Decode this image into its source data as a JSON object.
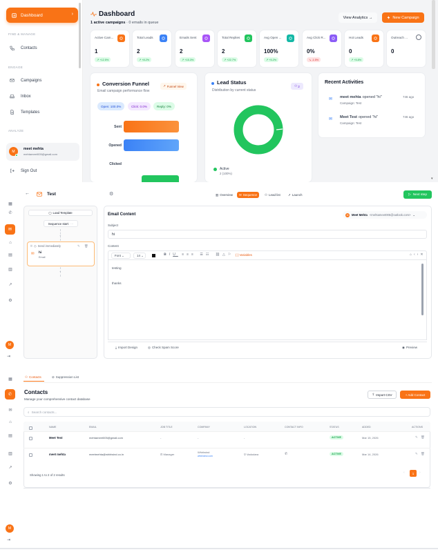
{
  "dashboard": {
    "nav": {
      "active": "Dashboard",
      "section_find": "FIND & MANAGE",
      "contacts": "Contacts",
      "section_engage": "ENGAGE",
      "campaigns": "Campaigns",
      "inbox": "Inbox",
      "templates": "Templates",
      "section_analyze": "ANALYZE",
      "user_name": "meet mehta",
      "user_email": "mehtameet005@gmail.com",
      "user_initial": "M",
      "sign_out": "Sign Out"
    },
    "title": "Dashboard",
    "subtitle_bold": "1 active campaigns",
    "subtitle_rest": "· 0 emails in queue",
    "view_analytics": "View Analytics →",
    "new_campaign": "New Campaign",
    "stats": [
      {
        "label": "Active Cam...",
        "value": "1",
        "change": "↗ +12.5%",
        "trend": "up",
        "color": "#f97316"
      },
      {
        "label": "Total Leads",
        "value": "2",
        "change": "↗ +8.2%",
        "trend": "up",
        "color": "#3b82f6"
      },
      {
        "label": "Emails Sent",
        "value": "2",
        "change": "↗ +15.3%",
        "trend": "up",
        "color": "#a855f7"
      },
      {
        "label": "Total Replies",
        "value": "2",
        "change": "↗ +22.7%",
        "trend": "up",
        "color": "#22c55e"
      },
      {
        "label": "Avg Open ...",
        "value": "100%",
        "change": "↗ +5.2%",
        "trend": "up",
        "color": "#14b8a6"
      },
      {
        "label": "Avg Click R...",
        "value": "0%",
        "change": "↘ -1.5%",
        "trend": "down",
        "color": "#8b5cf6"
      },
      {
        "label": "Hot Leads",
        "value": "0",
        "change": "↗ +5.8%",
        "trend": "up",
        "color": "#f97316"
      },
      {
        "label": "Outreach ...",
        "value": "0",
        "change": "",
        "trend": "none",
        "color": "#6b7280"
      }
    ],
    "funnel": {
      "title": "Conversion Funnel",
      "subtitle": "Email campaign performance flow",
      "button": "Funnel View",
      "pills": [
        "Open: 100.0%",
        "Click: 0.0%",
        "Reply: 0%"
      ],
      "stages": [
        {
          "label": "Sent",
          "value": 1.0
        },
        {
          "label": "Opened",
          "value": 1.0
        },
        {
          "label": "Clicked",
          "value": 0.0
        }
      ]
    },
    "lead_status": {
      "title": "Lead Status",
      "subtitle": "Distribution by current status",
      "count_badge": "2",
      "legend_label": "Active",
      "legend_value": "2 (100%)",
      "active_fraction": 1.0
    },
    "recent": {
      "title": "Recent Activities",
      "items": [
        {
          "name": "meet mehta",
          "action": "opened \"hi\"",
          "campaign": "Campaign: Test",
          "time": "746 ago"
        },
        {
          "name": "Meet Test",
          "action": "opened \"hi\"",
          "campaign": "Campaign: Test",
          "time": "746 ago"
        }
      ]
    }
  },
  "editor": {
    "campaign_name": "Test",
    "tabs": [
      "Overview",
      "Sequence",
      "Lead list",
      "Launch"
    ],
    "active_tab": "Sequence",
    "next_step": "Next step",
    "load_template": "Load Template",
    "sequence_start": "Sequence start:",
    "step_label": "Send immediately",
    "step_subject": "hi",
    "step_type": "Email",
    "email_content_title": "Email Content",
    "sender": "Meet Mehta",
    "sender_email": "<mehtameet005@outlook.com>",
    "subject_label": "Subject",
    "subject_value": "hi",
    "content_label": "Content",
    "toolbar": {
      "font": "Font",
      "size": "14",
      "variables": "{ } Variables"
    },
    "body_line1": "testing",
    "body_line2": "thanks",
    "import_design": "Import Design",
    "check_spam": "Check Spam Score",
    "preview": "Preview"
  },
  "contacts": {
    "tabs": [
      "Contacts",
      "Suppression List"
    ],
    "title": "Contacts",
    "subtitle": "Manage your comprehensive contact database",
    "import_csv": "Import CSV",
    "add_contact": "+ Add Contact",
    "search_placeholder": "Search contacts...",
    "columns": [
      "NAME",
      "EMAIL",
      "JOB TITLE",
      "COMPANY",
      "LOCATION",
      "CONTACT INFO",
      "STATUS",
      "ADDED",
      "ACTIONS"
    ],
    "rows": [
      {
        "name": "Meet Test",
        "email": "mehtameet005@gmail.com",
        "job": "-",
        "company": "-",
        "company_link": "",
        "location": "-",
        "status": "ACTIVE",
        "added": "Mar 15, 2026"
      },
      {
        "name": "meet mehta",
        "email": "meetmehta@whirlwind.co.in",
        "job": "Manager",
        "company": "Whirlwind",
        "company_link": "whirlwind.com",
        "location": "Vadodara",
        "status": "ACTIVE",
        "added": "Mar 14, 2026"
      }
    ],
    "footer": "Showing 1 to 2 of 2 results",
    "page": "1"
  },
  "colors": {
    "accent": "#f97316",
    "green": "#22c55e",
    "blue": "#3b82f6"
  }
}
